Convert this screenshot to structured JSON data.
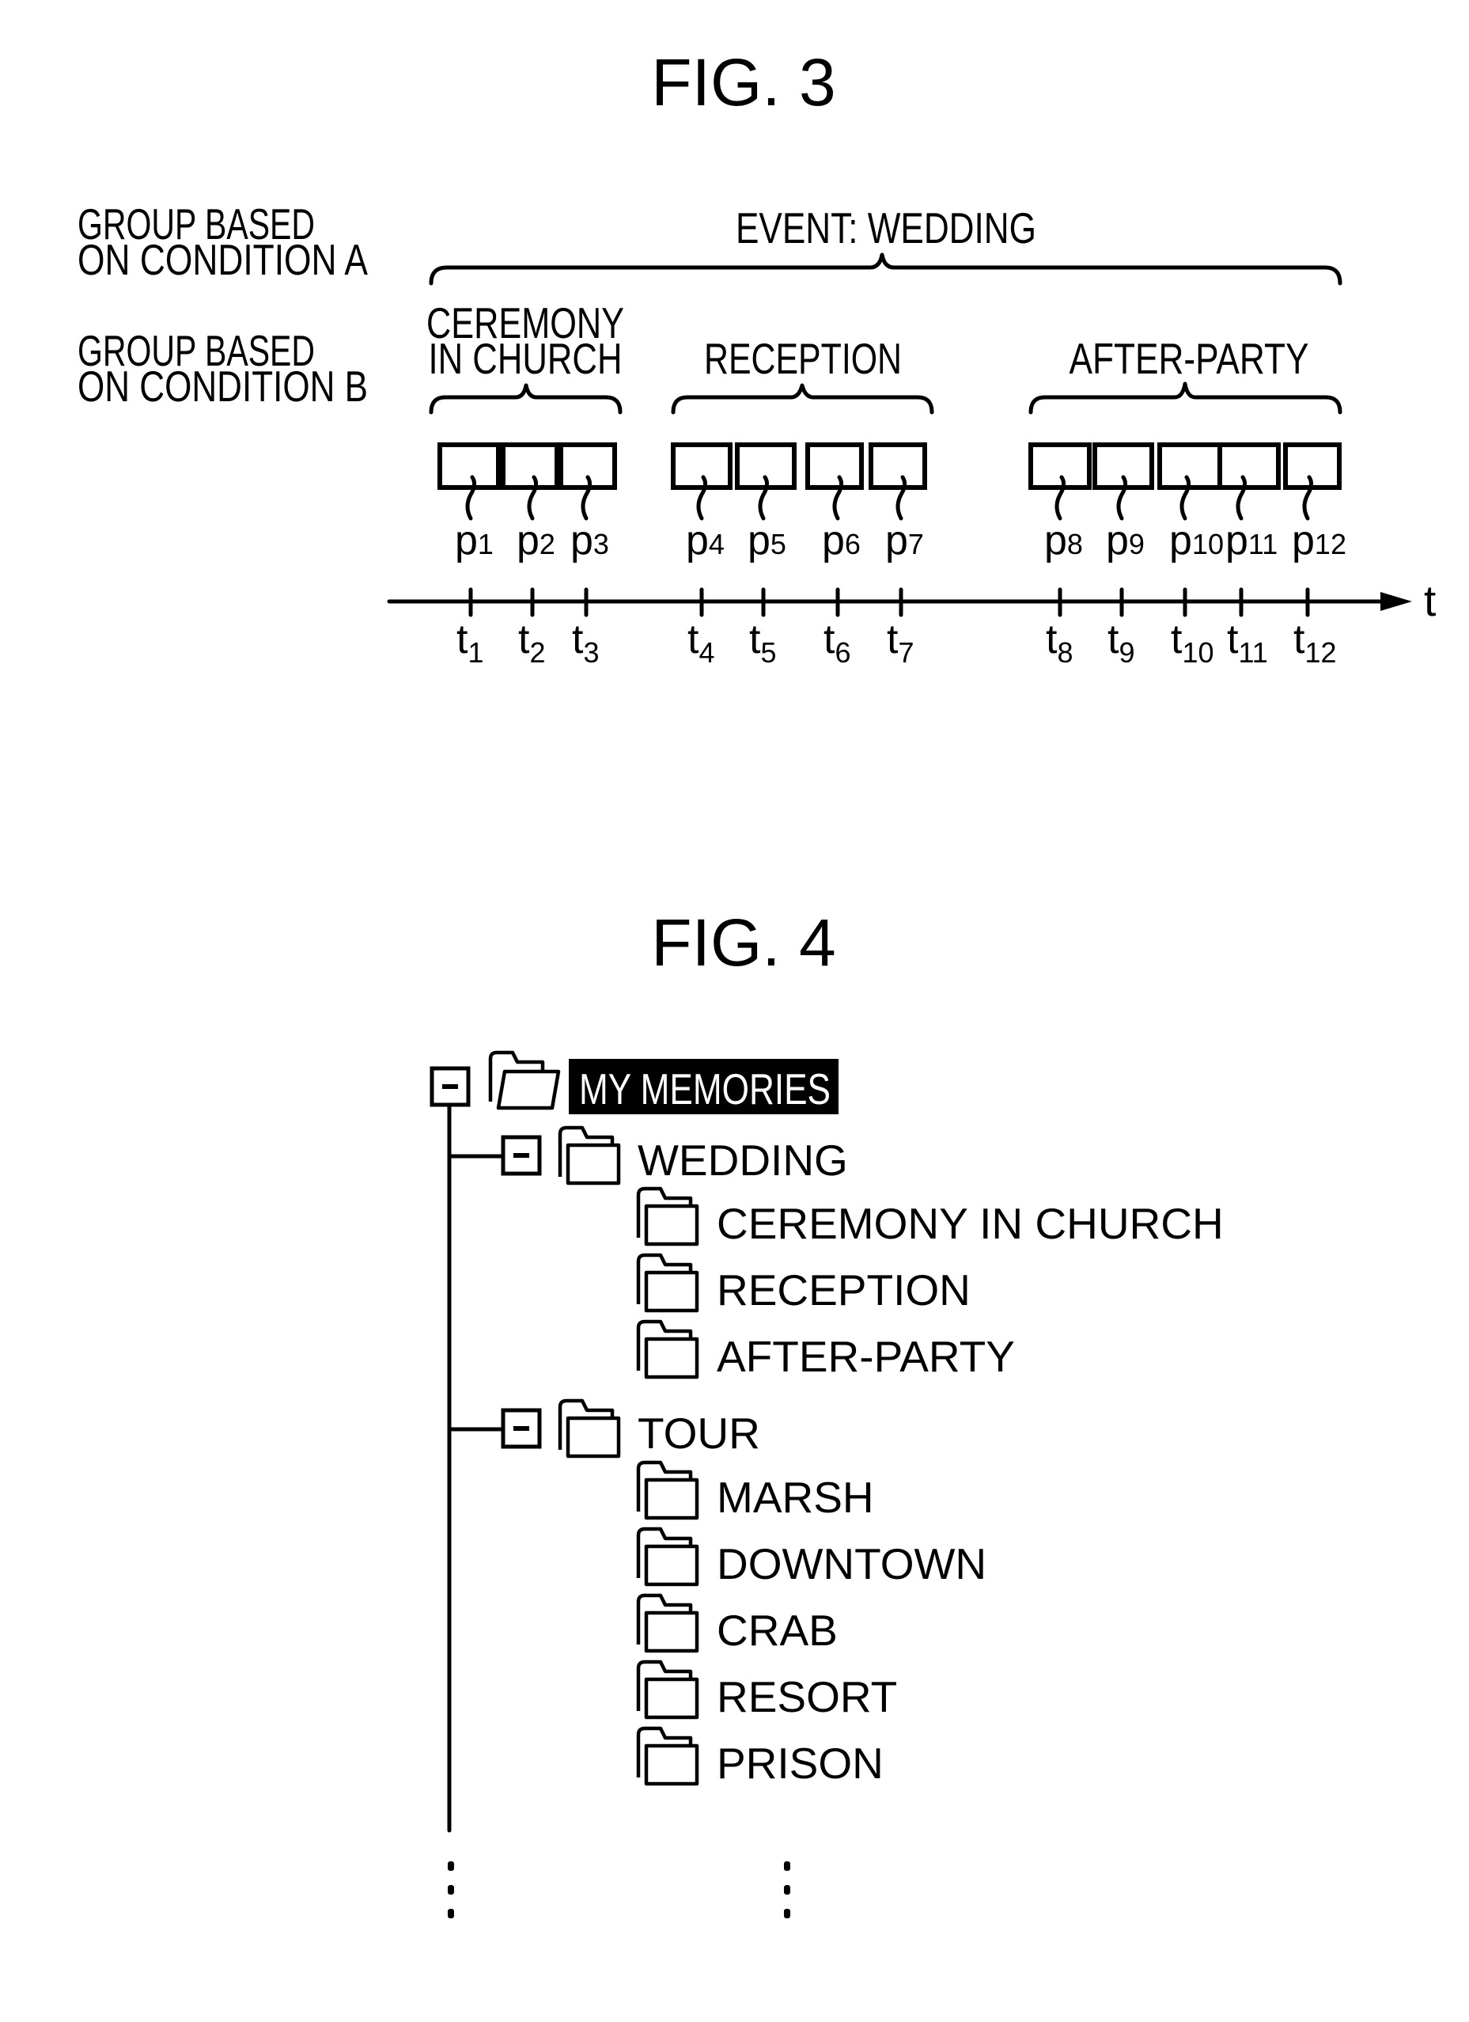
{
  "fig3": {
    "title": "FIG. 3",
    "row_labels": {
      "condition_a": [
        "GROUP BASED",
        "ON CONDITION A"
      ],
      "condition_b": [
        "GROUP BASED",
        "ON CONDITION B"
      ]
    },
    "event_label": "EVENT: WEDDING",
    "groups": [
      {
        "label_lines": [
          "CEREMONY",
          "IN CHURCH"
        ],
        "photos": [
          1,
          2,
          3
        ]
      },
      {
        "label_lines": [
          "RECEPTION"
        ],
        "photos": [
          4,
          5,
          6,
          7
        ]
      },
      {
        "label_lines": [
          "AFTER-PARTY"
        ],
        "photos": [
          8,
          9,
          10,
          11,
          12
        ]
      }
    ],
    "photo_prefix": "p",
    "time_prefix": "t",
    "axis_label": "t",
    "photos": [
      "1",
      "2",
      "3",
      "4",
      "5",
      "6",
      "7",
      "8",
      "9",
      "10",
      "11",
      "12"
    ]
  },
  "fig4": {
    "title": "FIG. 4",
    "root": {
      "label": "MY MEMORIES",
      "expanded": true,
      "selected": true
    },
    "children": [
      {
        "label": "WEDDING",
        "expanded": true,
        "children": [
          "CEREMONY IN CHURCH",
          "RECEPTION",
          "AFTER-PARTY"
        ]
      },
      {
        "label": "TOUR",
        "expanded": true,
        "children": [
          "MARSH",
          "DOWNTOWN",
          "CRAB",
          "RESORT",
          "PRISON"
        ]
      }
    ],
    "ellipsis": "⋮"
  }
}
